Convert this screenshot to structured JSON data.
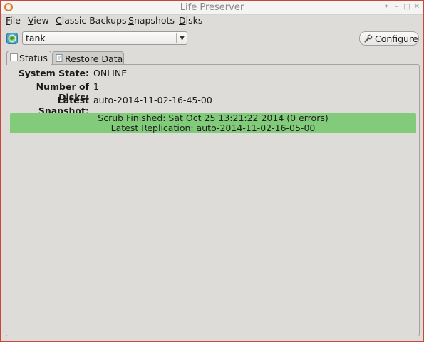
{
  "window": {
    "title": "Life Preserver"
  },
  "menu": {
    "file": "File",
    "view": "View",
    "classic_backups": "Classic Backups",
    "snapshots": "Snapshots",
    "disks": "Disks"
  },
  "pool": {
    "selected": "tank"
  },
  "toolbar": {
    "configure_label": "Configure"
  },
  "tabs": [
    {
      "label": "Status",
      "active": true
    },
    {
      "label": "Restore Data",
      "active": false
    }
  ],
  "status": {
    "fields": [
      {
        "label": "System State:",
        "value": "ONLINE"
      },
      {
        "label": "Number of Disks:",
        "value": "1"
      },
      {
        "label": "Latest Snapshot:",
        "value": "auto-2014-11-02-16-45-00"
      }
    ],
    "banner": {
      "line1": "Scrub Finished: Sat Oct 25 13:21:22 2014 (0 errors)",
      "line2": "Latest Replication: auto-2014-11-02-16-05-00",
      "color": "#82cb7b"
    }
  },
  "icons": {
    "app": "life-ring-icon",
    "pool": "pool-globe-icon",
    "configure": "wrench-icon"
  }
}
